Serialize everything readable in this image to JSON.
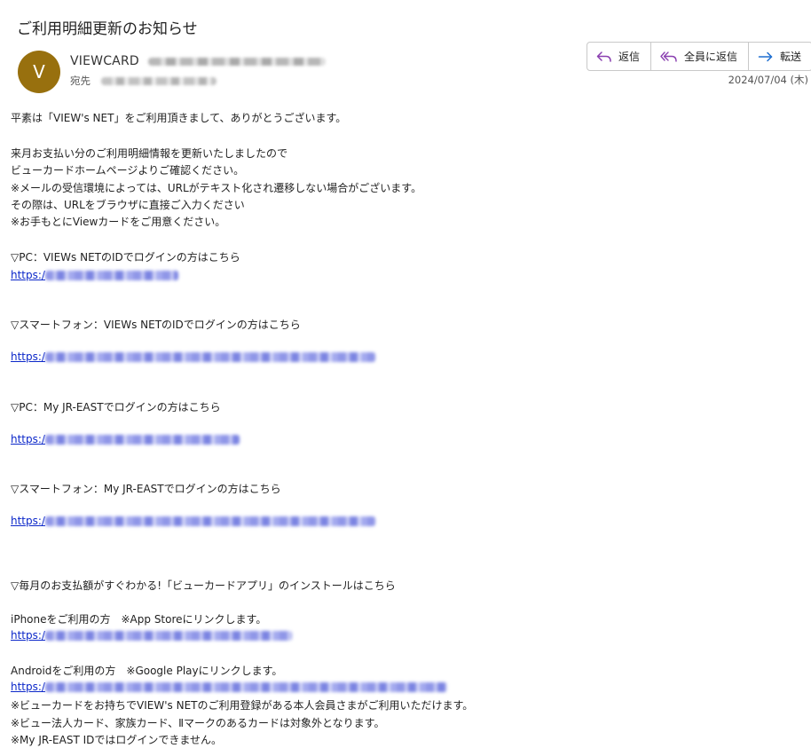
{
  "email": {
    "subject": "ご利用明細更新のお知らせ",
    "sender_initial": "V",
    "sender_name": "VIEWCARD",
    "to_label": "宛先",
    "date": "2024/07/04 (木)",
    "avatar_color": "#98700e"
  },
  "actions": {
    "reply": "返信",
    "reply_all": "全員に返信",
    "forward": "転送"
  },
  "body": {
    "greeting": "平素は「VIEW's NET」をご利用頂きまして、ありがとうございます。",
    "p1_l1": "来月お支払い分のご利用明細情報を更新いたしましたので",
    "p1_l2": "ビューカードホームページよりご確認ください。",
    "p1_l3": "※メールの受信環境によっては、URLがテキスト化され遷移しない場合がございます。",
    "p1_l4": "その際は、URLをブラウザに直接ご入力ください",
    "p1_l5": "※お手もとにViewカードをご用意ください。",
    "pc_views": "▽PC：VIEWs NETのIDでログインの方はこちら",
    "sp_views": "▽スマートフォン：VIEWs NETのIDでログインの方はこちら",
    "pc_jr": "▽PC：My JR-EASTでログインの方はこちら",
    "sp_jr": "▽スマートフォン：My JR-EASTでログインの方はこちら",
    "app_heading": "▽毎月のお支払額がすぐわかる!「ビューカードアプリ」のインストールはこちら",
    "iphone": "iPhoneをご利用の方　※App Storeにリンクします。",
    "android": "Androidをご利用の方　※Google Playにリンクします。",
    "note1": "※ビューカードをお持ちでVIEW's NETのご利用登録がある本人会員さまがご利用いただけます。",
    "note2": "※ビュー法人カード、家族カード、Ⅱマークのあるカードは対象外となります。",
    "note3": "※My JR-EAST IDではログインできません。",
    "link_prefix": "https:/"
  }
}
